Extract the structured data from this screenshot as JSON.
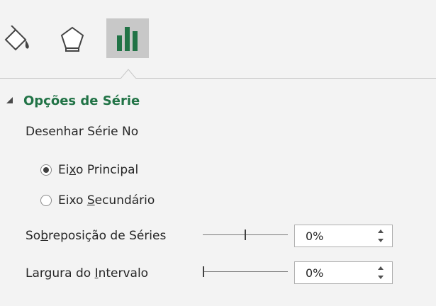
{
  "tabs": [
    {
      "icon": "paint-bucket-icon",
      "selected": false
    },
    {
      "icon": "pentagon-icon",
      "selected": false
    },
    {
      "icon": "bar-chart-icon",
      "selected": true
    }
  ],
  "colors": {
    "accent": "#217346",
    "panel": "#f3f3f3",
    "selected_tab": "#c8c8c8"
  },
  "section": {
    "title": "Opções de Série",
    "expanded": true,
    "plot_label": "Desenhar Série No",
    "radio_primary": {
      "pre": "Ei",
      "u": "x",
      "post": "o Principal",
      "checked": true
    },
    "radio_secondary": {
      "pre": "Eixo ",
      "u": "S",
      "post": "ecundário",
      "checked": false
    },
    "overlap": {
      "pre": "So",
      "u": "b",
      "post": "reposição de Séries",
      "value": "0%",
      "slider_level": 0.5
    },
    "gap": {
      "pre": "Largura do ",
      "u": "I",
      "post": "ntervalo",
      "value": "0%",
      "slider_level": 0.0
    }
  }
}
